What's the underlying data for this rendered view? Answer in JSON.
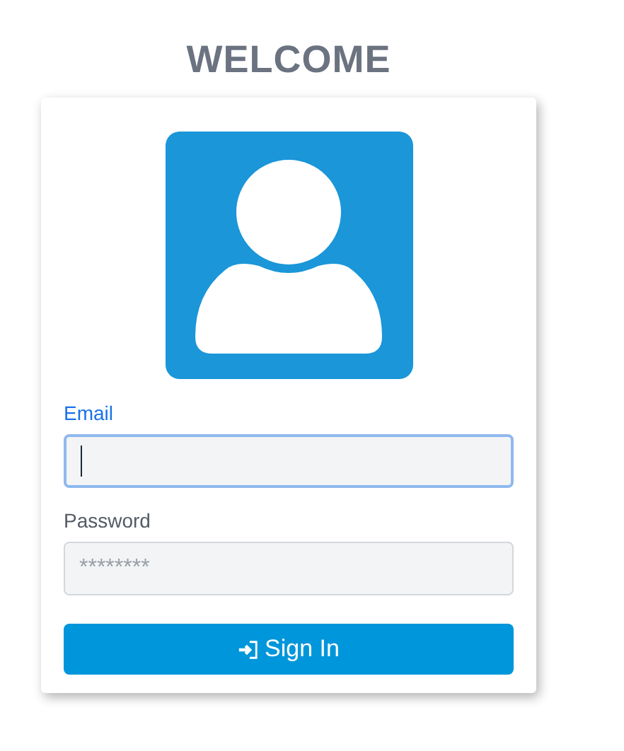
{
  "heading": "WELCOME",
  "fields": [
    {
      "label": "Email",
      "focused": true
    },
    {
      "label": "Password",
      "placeholder": "********",
      "focused": false
    }
  ],
  "button": {
    "label": "Sign In"
  }
}
